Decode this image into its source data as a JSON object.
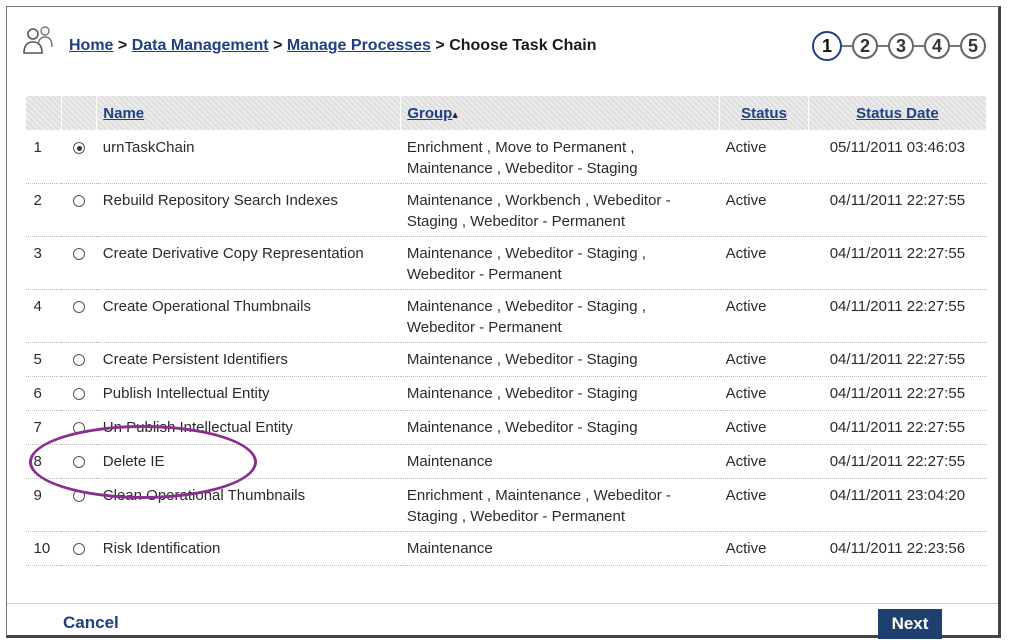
{
  "breadcrumb": {
    "home": "Home",
    "data_management": "Data Management",
    "manage_processes": "Manage Processes",
    "current": "Choose Task Chain",
    "separator": ">"
  },
  "steps": [
    "1",
    "2",
    "3",
    "4",
    "5"
  ],
  "active_step": "1",
  "table": {
    "headers": {
      "name": "Name",
      "group": "Group",
      "status": "Status",
      "status_date": "Status Date"
    },
    "sort_indicator": "▴",
    "rows": [
      {
        "num": "1",
        "selected": true,
        "name": "urnTaskChain",
        "group": "Enrichment , Move to Permanent , Maintenance , Webeditor - Staging",
        "status": "Active",
        "date": "05/11/2011 03:46:03"
      },
      {
        "num": "2",
        "selected": false,
        "name": "Rebuild Repository Search Indexes",
        "group": "Maintenance , Workbench , Webeditor - Staging , Webeditor - Permanent",
        "status": "Active",
        "date": "04/11/2011 22:27:55"
      },
      {
        "num": "3",
        "selected": false,
        "name": "Create Derivative Copy Representation",
        "group": "Maintenance , Webeditor - Staging , Webeditor - Permanent",
        "status": "Active",
        "date": "04/11/2011 22:27:55"
      },
      {
        "num": "4",
        "selected": false,
        "name": "Create Operational Thumbnails",
        "group": "Maintenance , Webeditor - Staging , Webeditor - Permanent",
        "status": "Active",
        "date": "04/11/2011 22:27:55"
      },
      {
        "num": "5",
        "selected": false,
        "name": "Create Persistent Identifiers",
        "group": "Maintenance , Webeditor - Staging",
        "status": "Active",
        "date": "04/11/2011 22:27:55"
      },
      {
        "num": "6",
        "selected": false,
        "name": "Publish Intellectual Entity",
        "group": "Maintenance , Webeditor - Staging",
        "status": "Active",
        "date": "04/11/2011 22:27:55"
      },
      {
        "num": "7",
        "selected": false,
        "name": "Un Publish Intellectual Entity",
        "group": "Maintenance , Webeditor - Staging",
        "status": "Active",
        "date": "04/11/2011 22:27:55"
      },
      {
        "num": "8",
        "selected": false,
        "name": "Delete IE",
        "group": "Maintenance",
        "status": "Active",
        "date": "04/11/2011 22:27:55"
      },
      {
        "num": "9",
        "selected": false,
        "name": "Clean Operational Thumbnails",
        "group": "Enrichment , Maintenance , Webeditor - Staging , Webeditor - Permanent",
        "status": "Active",
        "date": "04/11/2011 23:04:20"
      },
      {
        "num": "10",
        "selected": false,
        "name": "Risk Identification",
        "group": "Maintenance",
        "status": "Active",
        "date": "04/11/2011 22:23:56"
      }
    ]
  },
  "footer": {
    "cancel_label": "Cancel",
    "next_label": "Next"
  },
  "colors": {
    "link": "#1f3f86",
    "button": "#1f3f6e",
    "highlight_oval": "#8b2f8f"
  }
}
